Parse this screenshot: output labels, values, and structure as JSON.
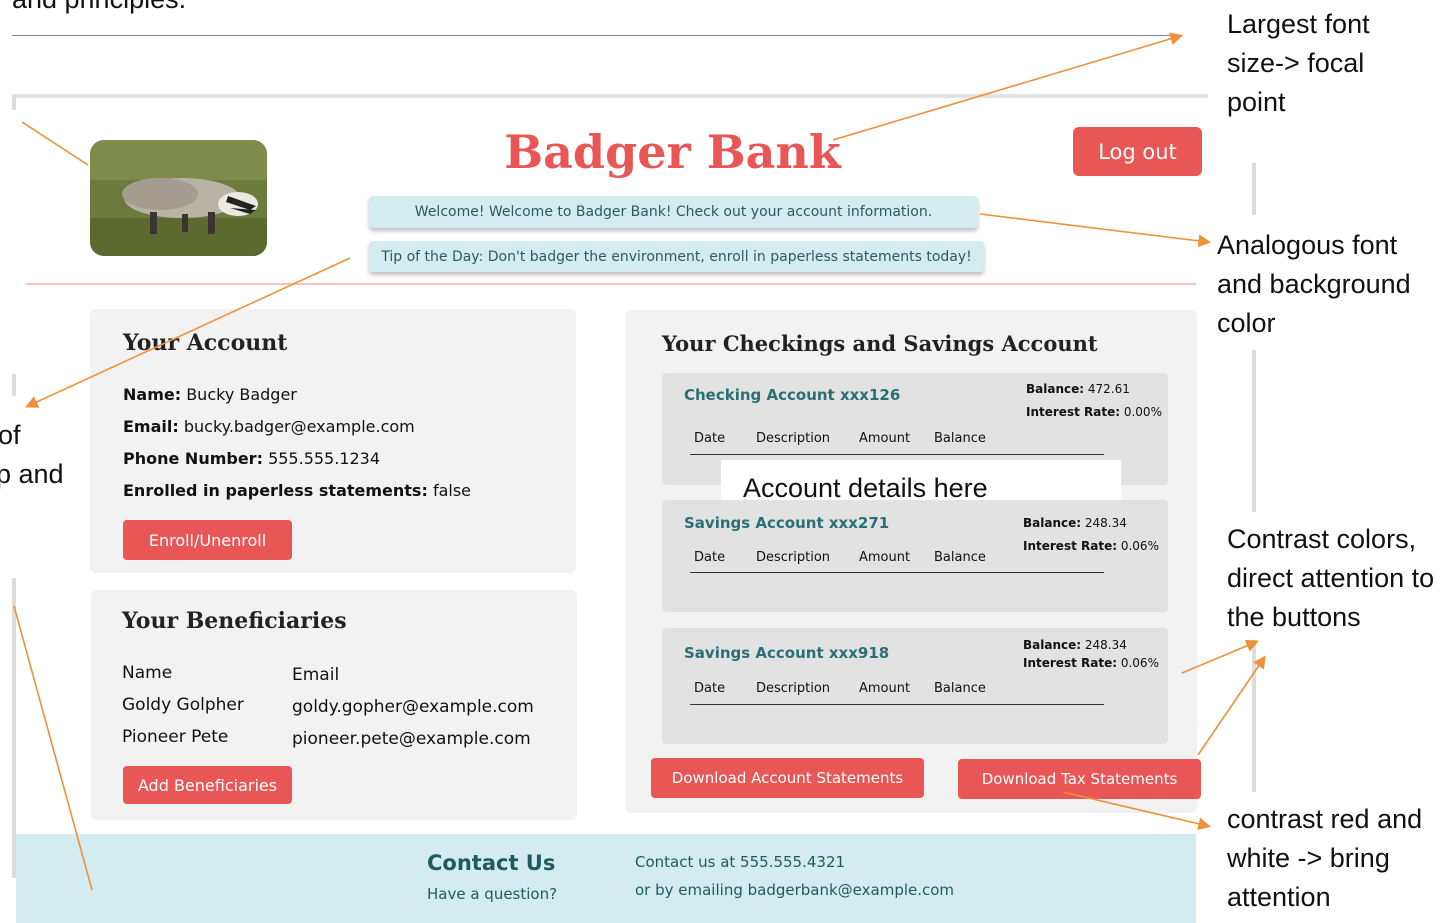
{
  "header_fragment": "and principles.",
  "annotations": {
    "focal": "Largest font size-> focal point",
    "analogous": "Analogous font and background color",
    "contrast_colors": "Contrast colors, direct attention to the buttons",
    "contrast_red": "contrast red and white -> bring attention",
    "left_clip_1": "of",
    "left_clip_2": "p and",
    "account_details": "Account details here"
  },
  "page": {
    "title": "Badger Bank",
    "logout": "Log out",
    "welcome": "Welcome! Welcome to Badger Bank! Check out your account information.",
    "tip": "Tip of the Day: Don't badger the environment, enroll in paperless statements today!"
  },
  "account": {
    "heading": "Your Account",
    "name_label": "Name:",
    "name": "Bucky Badger",
    "email_label": "Email:",
    "email": "bucky.badger@example.com",
    "phone_label": "Phone Number:",
    "phone": "555.555.1234",
    "paperless_label": "Enrolled in paperless statements:",
    "paperless": "false",
    "enroll_button": "Enroll/Unenroll"
  },
  "beneficiaries": {
    "heading": "Your Beneficiaries",
    "col_name": "Name",
    "col_email": "Email",
    "rows": [
      {
        "name": "Goldy Golpher",
        "email": "goldy.gopher@example.com"
      },
      {
        "name": "Pioneer Pete",
        "email": "pioneer.pete@example.com"
      }
    ],
    "add_button": "Add Beneficiaries"
  },
  "accounts_panel": {
    "heading": "Your Checkings and Savings Account",
    "balance_label": "Balance:",
    "rate_label": "Interest Rate:",
    "columns": [
      "Date",
      "Description",
      "Amount",
      "Balance"
    ],
    "accounts": [
      {
        "title": "Checking Account xxx126",
        "balance": "472.61",
        "rate": "0.00%"
      },
      {
        "title": "Savings Account xxx271",
        "balance": "248.34",
        "rate": "0.06%"
      },
      {
        "title": "Savings Account xxx918",
        "balance": "248.34",
        "rate": "0.06%"
      }
    ],
    "download_accounts": "Download Account Statements",
    "download_tax": "Download Tax Statements"
  },
  "contact": {
    "heading": "Contact Us",
    "question": "Have a question?",
    "line1": "Contact us at 555.555.4321",
    "line2": "or by emailing badgerbank@example.com"
  },
  "colors": {
    "accent_red": "#e85656",
    "banner_bg": "#d2ecef",
    "account_title": "#2a6f75",
    "arrow": "#f0913a"
  }
}
